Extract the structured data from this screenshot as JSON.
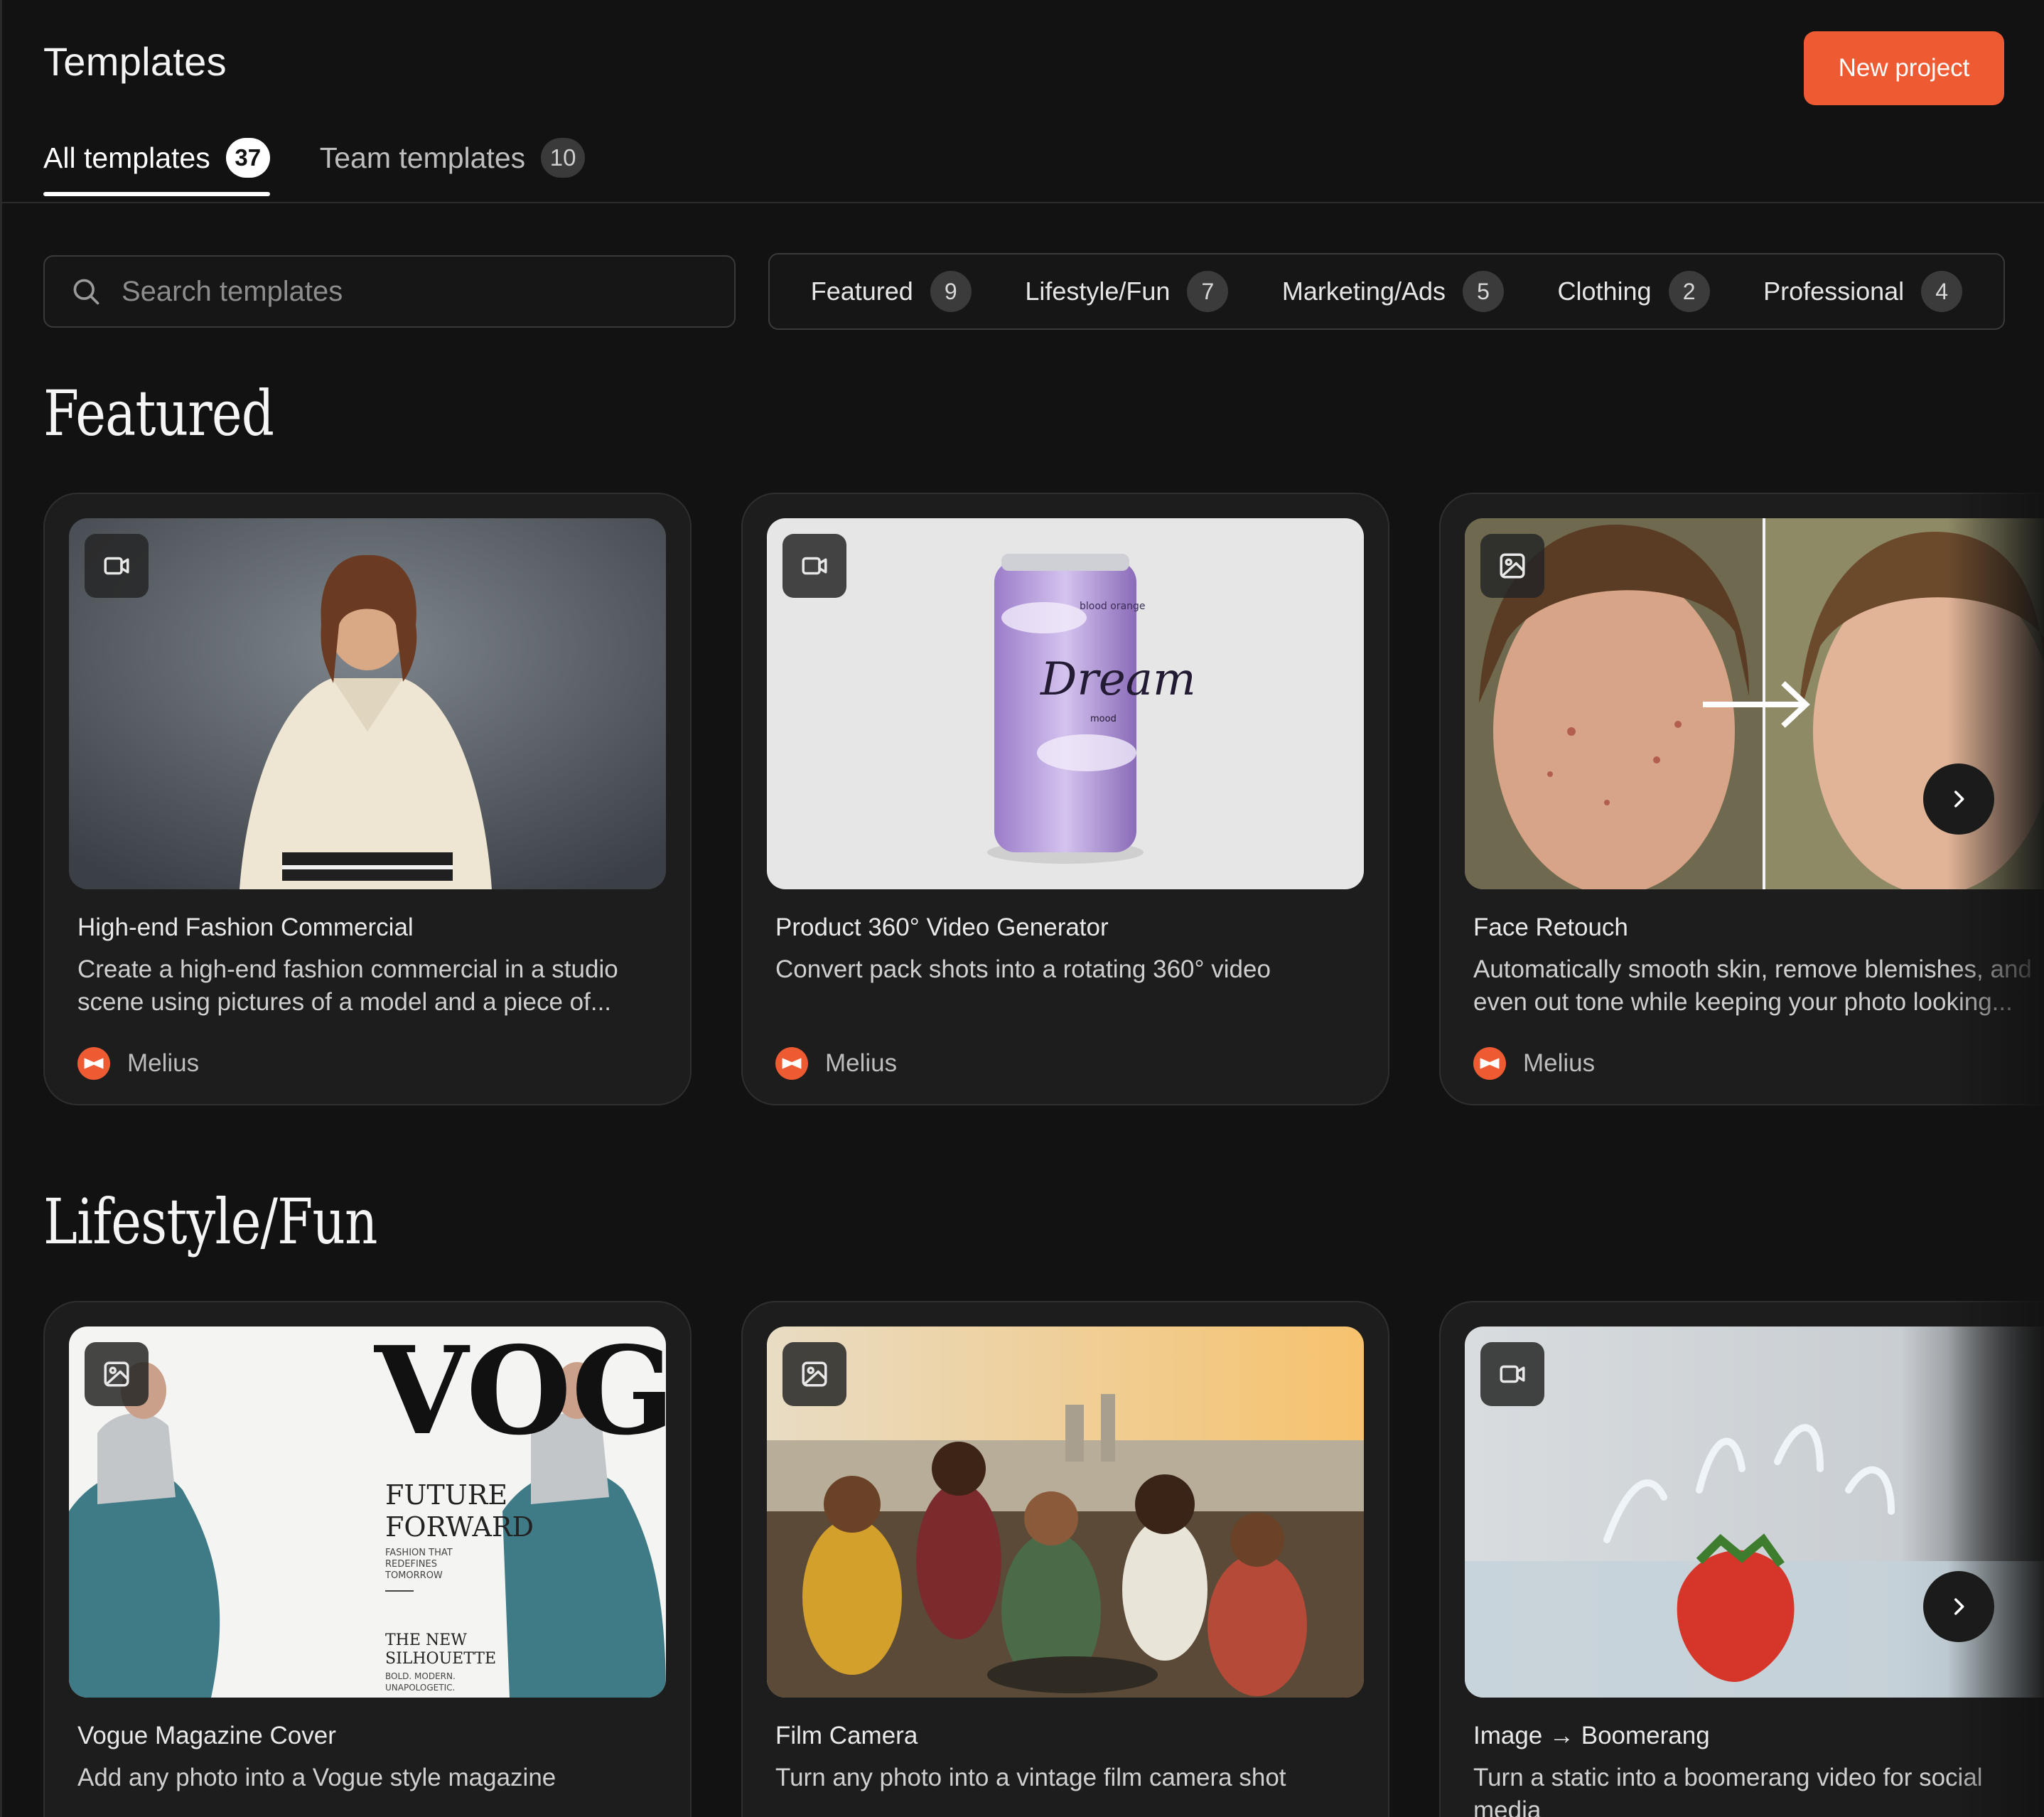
{
  "header": {
    "title": "Templates",
    "new_project_label": "New project"
  },
  "tabs": [
    {
      "label": "All templates",
      "count": "37"
    },
    {
      "label": "Team templates",
      "count": "10"
    }
  ],
  "search": {
    "placeholder": "Search templates"
  },
  "filters": [
    {
      "label": "Featured",
      "count": "9"
    },
    {
      "label": "Lifestyle/Fun",
      "count": "7"
    },
    {
      "label": "Marketing/Ads",
      "count": "5"
    },
    {
      "label": "Clothing",
      "count": "2"
    },
    {
      "label": "Professional",
      "count": "4"
    }
  ],
  "sections": {
    "featured": {
      "title": "Featured",
      "cards": [
        {
          "type_icon": "video-icon",
          "title": "High-end Fashion Commercial",
          "description": "Create a high-end fashion commercial in a studio scene using pictures of a model and a piece of...",
          "author": "Melius"
        },
        {
          "type_icon": "video-icon",
          "title": "Product 360° Video Generator",
          "description": "Convert pack shots into a rotating 360° video",
          "author": "Melius",
          "thumb_text": {
            "flavor": "blood orange",
            "brand": "Dream",
            "sub": "mood"
          }
        },
        {
          "type_icon": "image-icon",
          "title": "Face Retouch",
          "description": "Automatically smooth skin, remove blemishes, and even out tone while keeping your photo looking...",
          "author": "Melius"
        }
      ]
    },
    "lifestyle": {
      "title": "Lifestyle/Fun",
      "cards": [
        {
          "type_icon": "image-icon",
          "title": "Vogue Magazine Cover",
          "description": "Add any photo into a Vogue style magazine",
          "thumb_text": {
            "masthead": "VOGU",
            "headline1": "FUTURE",
            "headline2": "FORWARD",
            "sub1": "FASHION THAT",
            "sub2": "REDEFINES",
            "sub3": "TOMORROW",
            "feature1": "THE NEW",
            "feature2": "SILHOUETTE",
            "feature3": "BOLD. MODERN.",
            "feature4": "UNAPOLOGETIC."
          }
        },
        {
          "type_icon": "image-icon",
          "title": "Film Camera",
          "description": "Turn any photo into a vintage film camera shot"
        },
        {
          "type_icon": "video-icon",
          "title": "Image → Boomerang",
          "description": "Turn a static into a boomerang video for social media"
        }
      ]
    }
  },
  "colors": {
    "accent": "#ee5a32",
    "background": "#121212",
    "card": "#1d1d1d"
  }
}
